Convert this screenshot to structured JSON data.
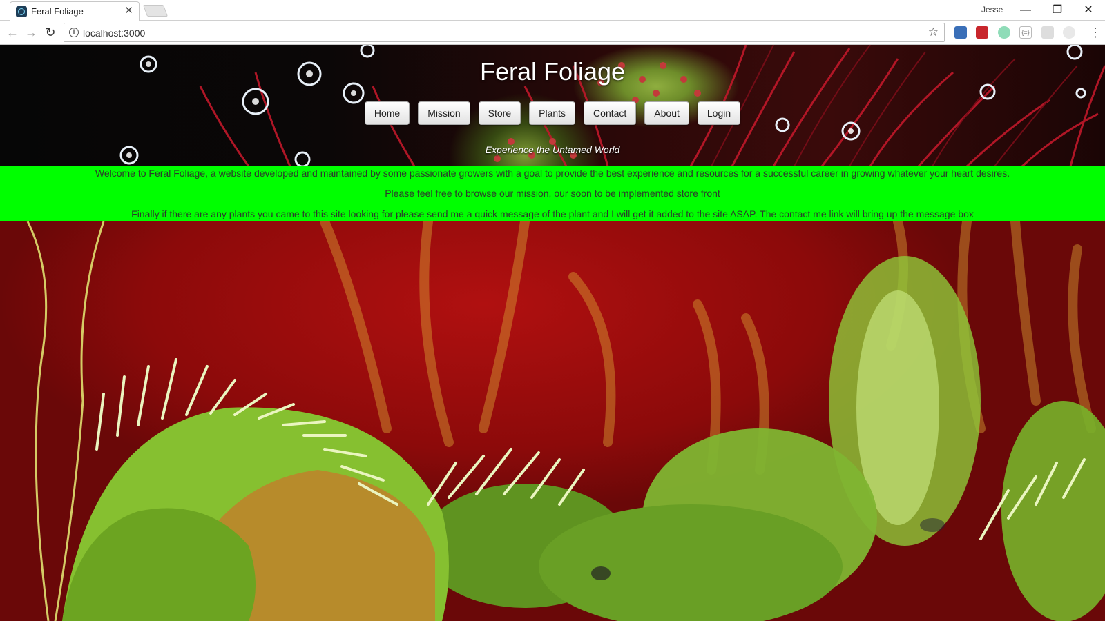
{
  "browser": {
    "tab_title": "Feral Foliage",
    "tab_close": "✕",
    "profile_name": "Jesse",
    "url": "localhost:3000",
    "window_minimize": "—",
    "window_restore": "❐",
    "window_close": "✕"
  },
  "icons": {
    "back": "back-arrow-icon",
    "forward": "forward-arrow-icon",
    "reload": "reload-icon",
    "info": "info-icon",
    "star": "star-icon",
    "menu": "menu-dots-icon"
  },
  "site": {
    "title": "Feral Foliage",
    "tagline": "Experience the Untamed World",
    "nav": [
      "Home",
      "Mission",
      "Store",
      "Plants",
      "Contact",
      "About",
      "Login"
    ],
    "welcome": [
      "Welcome to Feral Foliage, a website developed and maintained by some passionate growers with a goal to provide the best experience and resources for a successful career in growing whatever your heart desires.",
      "Please feel free to browse our mission, our soon to be implemented store front",
      "Finally if there are any plants you came to this site looking for please send me a quick message of the plant and I will get it added to the site ASAP. The contact me link will bring up the message box"
    ]
  },
  "colors": {
    "welcome_bg": "#00ff00",
    "hero_red": "#a00c0c",
    "trap_green": "#7dbb2a"
  }
}
